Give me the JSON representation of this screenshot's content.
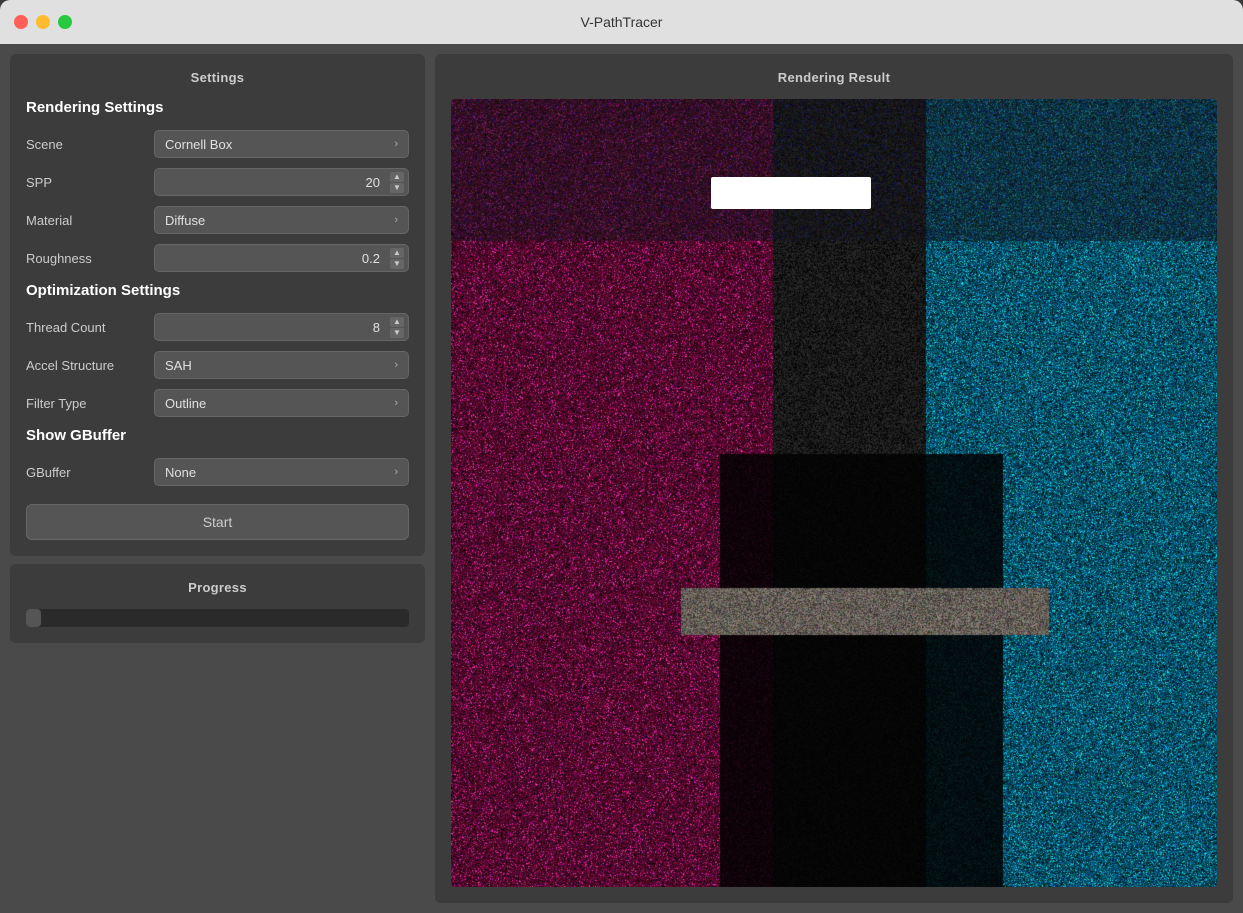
{
  "titleBar": {
    "title": "V-PathTracer",
    "buttons": [
      "close",
      "minimize",
      "maximize"
    ]
  },
  "leftPanel": {
    "header": "Settings",
    "renderingSettings": {
      "title": "Rendering Settings",
      "fields": [
        {
          "label": "Scene",
          "type": "dropdown",
          "value": "Cornell Box"
        },
        {
          "label": "SPP",
          "type": "spinner",
          "value": "20"
        },
        {
          "label": "Material",
          "type": "dropdown",
          "value": "Diffuse"
        },
        {
          "label": "Roughness",
          "type": "spinner",
          "value": "0.2"
        }
      ]
    },
    "optimizationSettings": {
      "title": "Optimization Settings",
      "fields": [
        {
          "label": "Thread Count",
          "type": "spinner",
          "value": "8"
        },
        {
          "label": "Accel Structure",
          "type": "dropdown",
          "value": "SAH"
        },
        {
          "label": "Filter Type",
          "type": "dropdown",
          "value": "Outline"
        }
      ]
    },
    "gbufferSettings": {
      "title": "Show GBuffer",
      "fields": [
        {
          "label": "GBuffer",
          "type": "dropdown",
          "value": "None"
        }
      ]
    },
    "startButton": "Start"
  },
  "progressPanel": {
    "header": "Progress",
    "progressValue": 4
  },
  "rightPanel": {
    "header": "Rendering Result"
  }
}
